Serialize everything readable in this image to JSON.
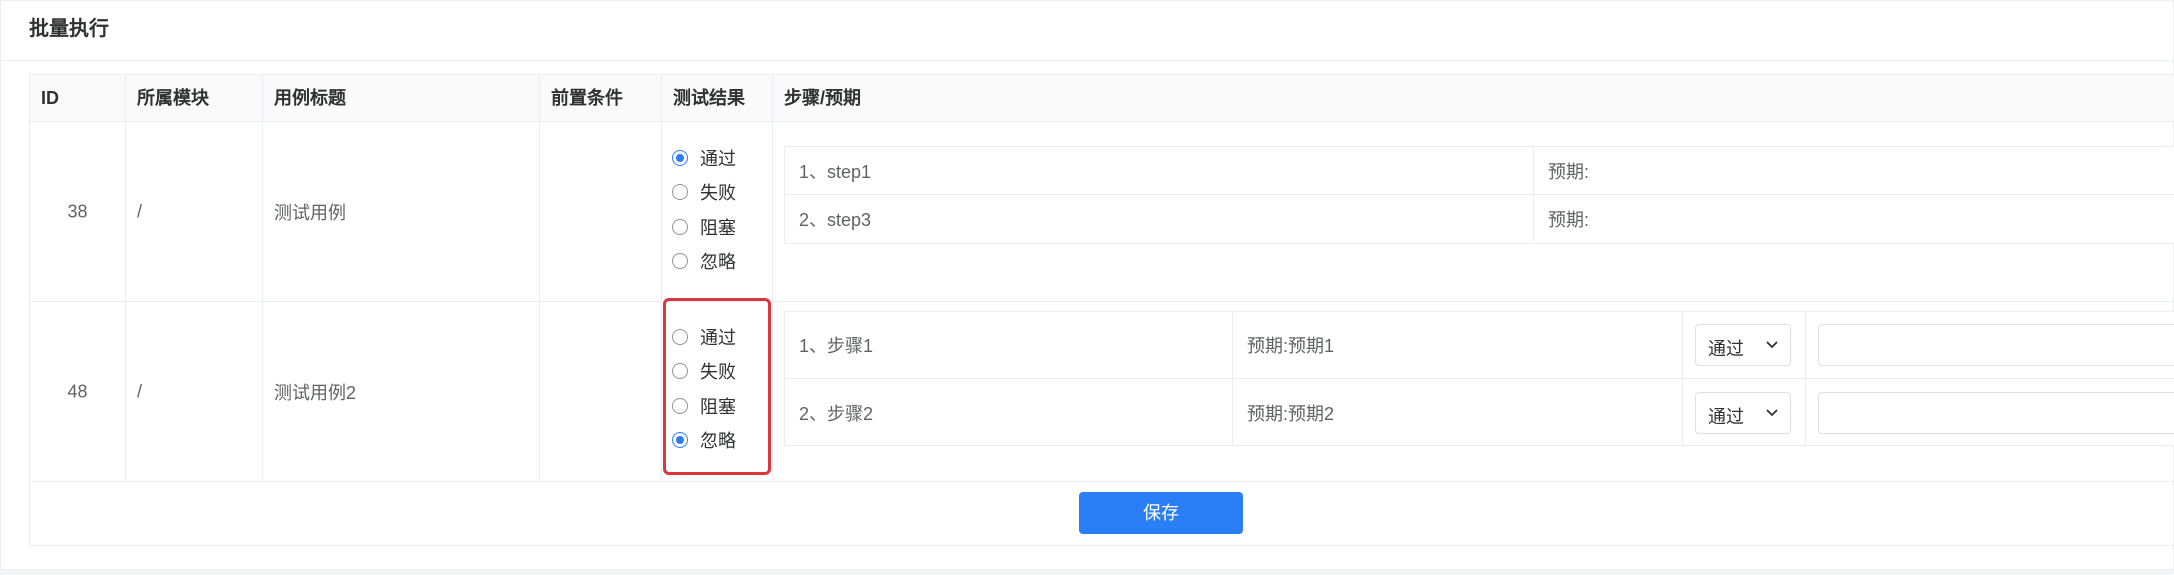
{
  "panel": {
    "title": "批量执行"
  },
  "table": {
    "headers": {
      "id": "ID",
      "module": "所属模块",
      "title": "用例标题",
      "precondition": "前置条件",
      "result": "测试结果",
      "steps": "步骤/预期"
    },
    "rows": [
      {
        "id": "38",
        "module": "/",
        "title": "测试用例",
        "precondition": "",
        "result_options": [
          "通过",
          "失败",
          "阻塞",
          "忽略"
        ],
        "selected_result": "通过",
        "steps": [
          {
            "step": "1、step1",
            "expected": "预期:"
          },
          {
            "step": "2、step3",
            "expected": "预期:"
          }
        ]
      },
      {
        "id": "48",
        "module": "/",
        "title": "测试用例2",
        "precondition": "",
        "result_options": [
          "通过",
          "失败",
          "阻塞",
          "忽略"
        ],
        "selected_result": "忽略",
        "steps": [
          {
            "step": "1、步骤1",
            "expected": "预期:预期1",
            "result": "通过",
            "remark": ""
          },
          {
            "step": "2、步骤2",
            "expected": "预期:预期2",
            "result": "通过",
            "remark": ""
          }
        ]
      }
    ]
  },
  "actions": {
    "save_label": "保存"
  },
  "colors": {
    "primary": "#2b7ff6",
    "highlight": "#d9363e",
    "border": "#ebeef5"
  }
}
